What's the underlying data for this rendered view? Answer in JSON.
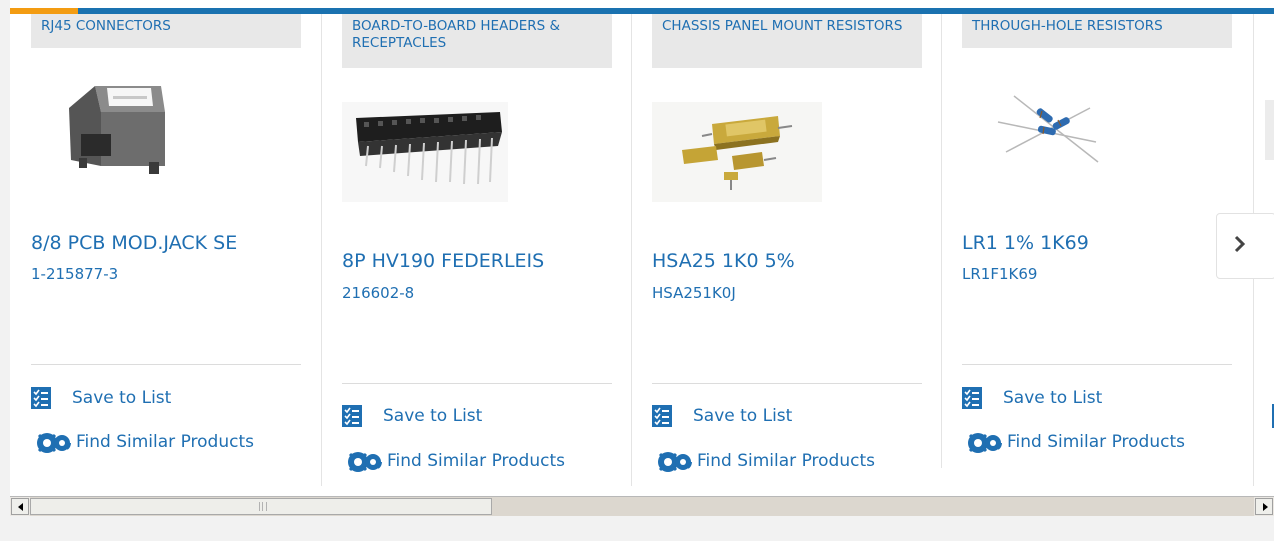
{
  "products": [
    {
      "category": "RJ45 CONNECTORS",
      "title": "8/8 PCB MOD.JACK SE",
      "part_number": "1-215877-3",
      "image": "rj45-jack-image",
      "save_label": "Save to List",
      "find_label": "Find Similar Products"
    },
    {
      "category": "BOARD-TO-BOARD HEADERS & RECEPTACLES",
      "title": "8P HV190 FEDERLEIS",
      "part_number": "216602-8",
      "image": "header-receptacle-image",
      "save_label": "Save to List",
      "find_label": "Find Similar Products"
    },
    {
      "category": "CHASSIS PANEL MOUNT RESISTORS",
      "title": "HSA25 1K0 5%",
      "part_number": "HSA251K0J",
      "image": "chassis-resistor-image",
      "save_label": "Save to List",
      "find_label": "Find Similar Products"
    },
    {
      "category": "THROUGH-HOLE RESISTORS",
      "title": "LR1 1% 1K69",
      "part_number": "LR1F1K69",
      "image": "through-hole-resistor-image",
      "save_label": "Save to List",
      "find_label": "Find Similar Products"
    }
  ],
  "carousel": {
    "next_icon": "chevron-right-icon"
  },
  "colors": {
    "link": "#1f6fb2",
    "top_bar": "#1a72b0",
    "top_accent": "#f39c12",
    "category_bg": "#e8e8e8"
  },
  "icons": {
    "save": "checklist-icon",
    "find": "gears-icon",
    "scroll_left": "scroll-left-arrow-icon",
    "scroll_right": "scroll-right-arrow-icon"
  }
}
